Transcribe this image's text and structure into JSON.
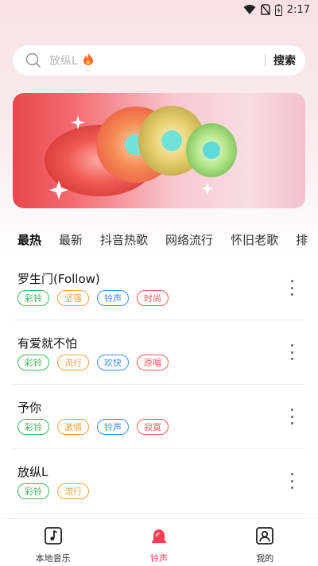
{
  "status": {
    "time": "2:17"
  },
  "search": {
    "placeholder": "放纵L",
    "button": "搜索"
  },
  "tabs": [
    "最热",
    "最新",
    "抖音热歌",
    "网络流行",
    "怀旧老歌",
    "排"
  ],
  "songs": [
    {
      "title": "罗生门(Follow)",
      "tags": [
        "彩铃",
        "坚强",
        "铃声",
        "时尚"
      ]
    },
    {
      "title": "有爱就不怕",
      "tags": [
        "彩铃",
        "流行",
        "欢快",
        "原唱"
      ]
    },
    {
      "title": "予你",
      "tags": [
        "彩铃",
        "激情",
        "铃声",
        "寂寞"
      ]
    },
    {
      "title": "放纵L",
      "tags": [
        "彩铃",
        "流行"
      ]
    }
  ],
  "nav": {
    "local": "本地音乐",
    "ringtone": "铃声",
    "mine": "我的"
  },
  "colors": {
    "accent": "#ff3d57",
    "tag_green": "#3cba5b",
    "tag_orange": "#f5a23a",
    "tag_blue": "#3a8ef5",
    "tag_red": "#ef5b5b"
  }
}
